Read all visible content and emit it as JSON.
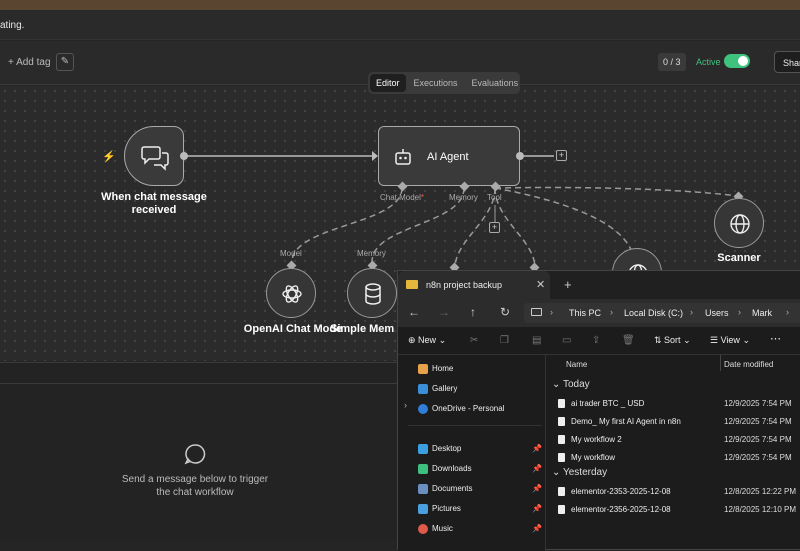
{
  "notice": {
    "text": "ating."
  },
  "header": {
    "add_tag": "+ Add tag",
    "counter": "0 / 3",
    "active_label": "Active",
    "share": "Shar"
  },
  "tabs": [
    "Editor",
    "Executions",
    "Evaluations"
  ],
  "nodes": {
    "trigger": {
      "label_line1": "When chat message",
      "label_line2": "received"
    },
    "agent": {
      "label": "AI Agent"
    },
    "openai": {
      "label": "OpenAI Chat Mode"
    },
    "memory": {
      "label": "Simple Mem"
    },
    "scanner": {
      "label": "Scanner"
    }
  },
  "ports": {
    "chat_model": "Chat Model",
    "chat_model_required": "*",
    "memory": "Memory",
    "tool": "Tool",
    "model_top": "Model",
    "memory_top": "Memory"
  },
  "chat_panel": {
    "hint_line1": "Send a message below to trigger",
    "hint_line2": "the chat workflow"
  },
  "explorer": {
    "tab_title": "n8n project backup",
    "breadcrumbs": [
      "This PC",
      "Local Disk (C:)",
      "Users",
      "Mark"
    ],
    "toolbar": {
      "new": "New",
      "sort": "Sort",
      "view": "View"
    },
    "nav_items": [
      {
        "label": "Home",
        "icon": "home-icon"
      },
      {
        "label": "Gallery",
        "icon": "gallery-icon"
      },
      {
        "label": "OneDrive - Personal",
        "icon": "cloud-icon"
      },
      {
        "label": "Desktop",
        "icon": "desktop-icon"
      },
      {
        "label": "Downloads",
        "icon": "download-icon"
      },
      {
        "label": "Documents",
        "icon": "documents-icon"
      },
      {
        "label": "Pictures",
        "icon": "pictures-icon"
      },
      {
        "label": "Music",
        "icon": "music-icon"
      }
    ],
    "columns": {
      "name": "Name",
      "date": "Date modified"
    },
    "groups": [
      {
        "label": "Today",
        "files": [
          {
            "name": "ai trader BTC _ USD",
            "date": "12/9/2025 7:54 PM"
          },
          {
            "name": "Demo_ My first AI Agent in n8n",
            "date": "12/9/2025 7:54 PM"
          },
          {
            "name": "My workflow 2",
            "date": "12/9/2025 7:54 PM"
          },
          {
            "name": "My workflow",
            "date": "12/9/2025 7:54 PM"
          }
        ]
      },
      {
        "label": "Yesterday",
        "files": [
          {
            "name": "elementor-2353-2025-12-08",
            "date": "12/8/2025 12:22 PM"
          },
          {
            "name": "elementor-2356-2025-12-08",
            "date": "12/8/2025 12:10 PM"
          }
        ]
      }
    ]
  },
  "colors": {
    "active_green": "#3ec27e",
    "trigger_bolt": "#ff5a3c",
    "folder_yellow": "#e6b53c"
  }
}
